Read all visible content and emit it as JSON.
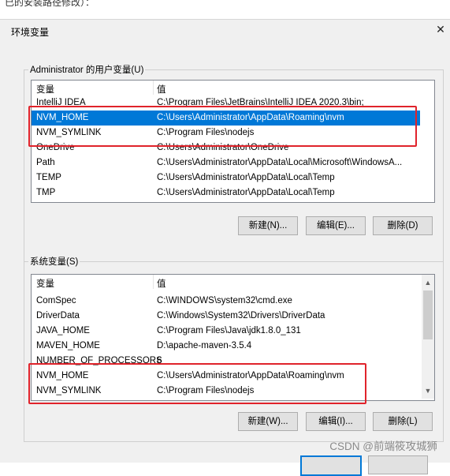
{
  "top_text": "已的安装路径修改）：",
  "dialog": {
    "title": "环境变量",
    "close_glyph": "✕"
  },
  "user_section": {
    "label": "Administrator 的用户变量(U)",
    "header": {
      "var": "变量",
      "val": "值"
    },
    "rows": [
      {
        "name": "IntelliJ IDEA",
        "value": "C:\\Program Files\\JetBrains\\IntelliJ IDEA 2020.3\\bin;"
      },
      {
        "name": "NVM_HOME",
        "value": "C:\\Users\\Administrator\\AppData\\Roaming\\nvm"
      },
      {
        "name": "NVM_SYMLINK",
        "value": "C:\\Program Files\\nodejs"
      },
      {
        "name": "OneDrive",
        "value": "C:\\Users\\Administrator\\OneDrive"
      },
      {
        "name": "Path",
        "value": "C:\\Users\\Administrator\\AppData\\Local\\Microsoft\\WindowsA..."
      },
      {
        "name": "TEMP",
        "value": "C:\\Users\\Administrator\\AppData\\Local\\Temp"
      },
      {
        "name": "TMP",
        "value": "C:\\Users\\Administrator\\AppData\\Local\\Temp"
      }
    ],
    "buttons": {
      "new": "新建(N)...",
      "edit": "编辑(E)...",
      "delete": "删除(D)"
    }
  },
  "system_section": {
    "label": "系统变量(S)",
    "header": {
      "var": "变量",
      "val": "值"
    },
    "rows": [
      {
        "name": "ComSpec",
        "value": "C:\\WINDOWS\\system32\\cmd.exe"
      },
      {
        "name": "DriverData",
        "value": "C:\\Windows\\System32\\Drivers\\DriverData"
      },
      {
        "name": "JAVA_HOME",
        "value": "C:\\Program Files\\Java\\jdk1.8.0_131"
      },
      {
        "name": "MAVEN_HOME",
        "value": "D:\\apache-maven-3.5.4"
      },
      {
        "name": "NUMBER_OF_PROCESSORS",
        "value": "6"
      },
      {
        "name": "NVM_HOME",
        "value": "C:\\Users\\Administrator\\AppData\\Roaming\\nvm"
      },
      {
        "name": "NVM_SYMLINK",
        "value": "C:\\Program Files\\nodejs"
      }
    ],
    "buttons": {
      "new": "新建(W)...",
      "edit": "编辑(I)...",
      "delete": "删除(L)"
    }
  },
  "watermark": "CSDN @前端筱攻城狮",
  "icons": {
    "scroll_up": "chevron-up-icon",
    "scroll_down": "chevron-down-icon",
    "close": "close-icon"
  },
  "colors": {
    "selection": "#0078d7",
    "highlight_box": "#e0232b"
  }
}
